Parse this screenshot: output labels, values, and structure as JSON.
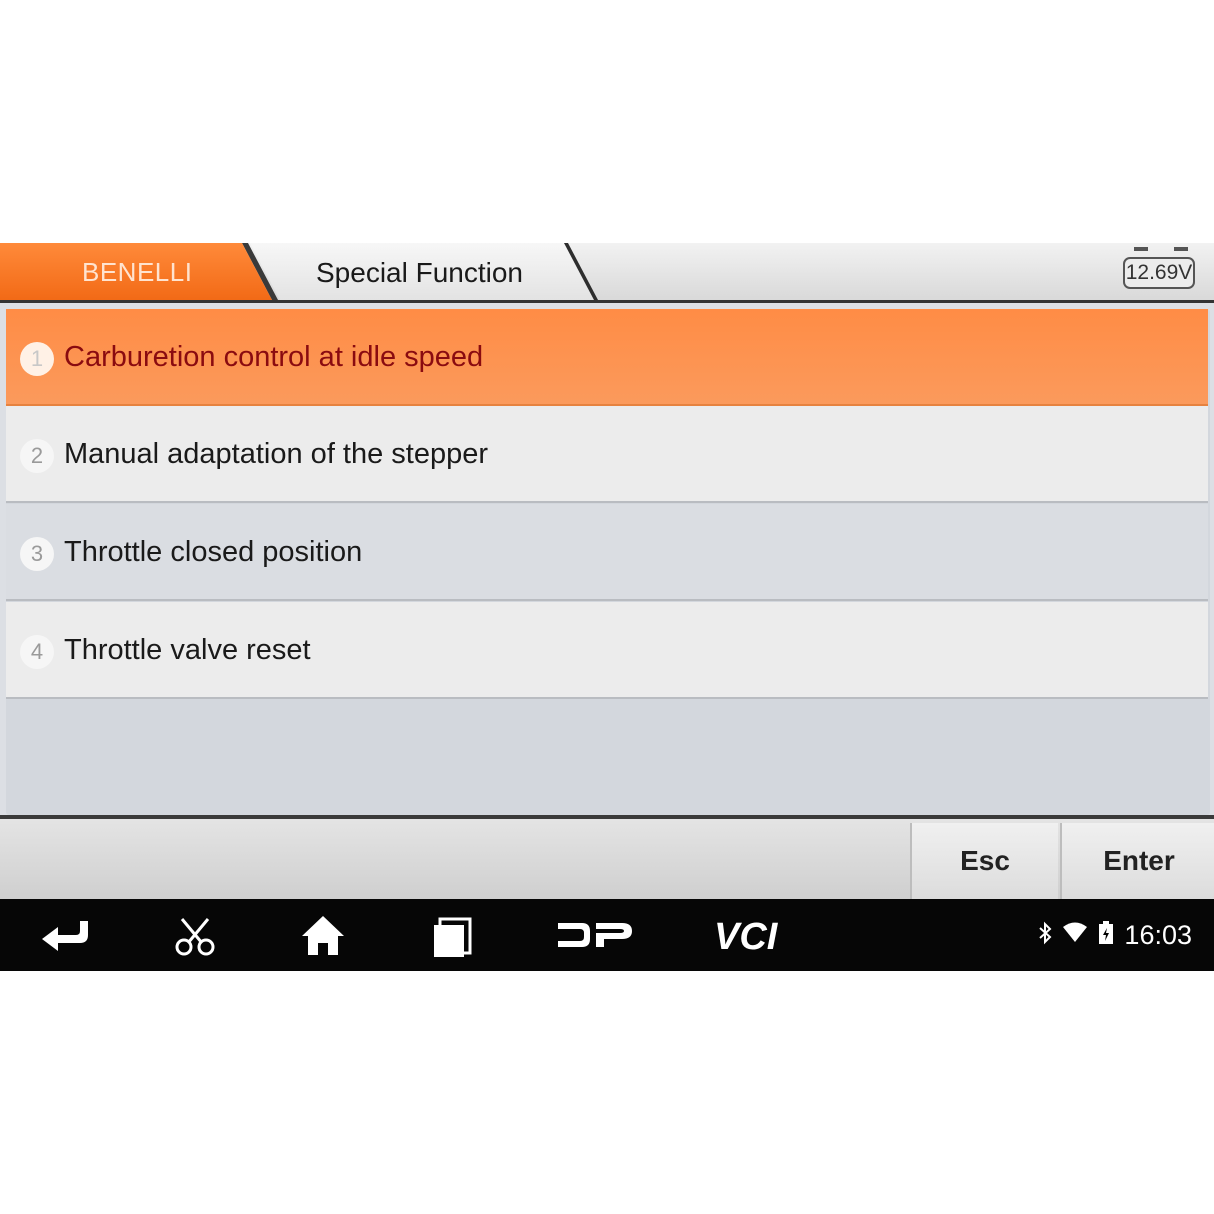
{
  "header": {
    "brand": "BENELLI",
    "breadcrumb": "Special Function",
    "voltage": "12.69V"
  },
  "menu": {
    "items": [
      {
        "num": "1",
        "label": "Carburetion control at idle speed",
        "selected": true
      },
      {
        "num": "2",
        "label": "Manual adaptation of the stepper",
        "selected": false
      },
      {
        "num": "3",
        "label": "Throttle closed position",
        "selected": false
      },
      {
        "num": "4",
        "label": "Throttle valve reset",
        "selected": false
      }
    ]
  },
  "buttons": {
    "esc": "Esc",
    "enter": "Enter"
  },
  "navbar": {
    "icons": [
      "back-icon",
      "scissors-icon",
      "home-icon",
      "recent-apps-icon",
      "dp-icon",
      "vci-icon"
    ]
  },
  "status": {
    "time": "16:03",
    "icons": [
      "bluetooth-icon",
      "wifi-icon",
      "battery-icon"
    ]
  },
  "colors": {
    "accent": "#f26a16",
    "selected_row": "#fb9a5c",
    "selected_text": "#8a0b10"
  }
}
